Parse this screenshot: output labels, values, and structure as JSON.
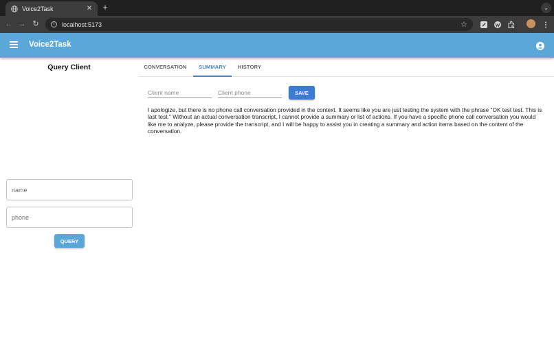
{
  "browser": {
    "tab_title": "Voice2Task",
    "url": "localhost:5173",
    "tab_close_glyph": "✕",
    "new_tab_glyph": "+",
    "tab_list_glyph": "⌄",
    "back_glyph": "←",
    "forward_glyph": "→",
    "reload_glyph": "↻",
    "info_glyph": "i",
    "star_glyph": "☆"
  },
  "appbar": {
    "title": "Voice2Task",
    "menu_icon": "menu-icon",
    "account_icon": "account-circle-icon",
    "color": "#5ba7d8"
  },
  "left_panel": {
    "title": "Query Client",
    "name_placeholder": "name",
    "phone_placeholder": "phone",
    "query_label": "QUERY"
  },
  "tabs": [
    {
      "label": "CONVERSATION",
      "active": false
    },
    {
      "label": "SUMMARY",
      "active": true
    },
    {
      "label": "HISTORY",
      "active": false
    }
  ],
  "summary": {
    "client_name_placeholder": "Client name",
    "client_phone_placeholder": "Client phone",
    "save_label": "SAVE",
    "text": "I apologize, but there is no phone call conversation provided in the context. It seems like you are just testing the system with the phrase \"OK test test. This is last test.\" Without an actual conversation transcript, I cannot provide a summary or list of actions. If you have a specific phone call conversation you would like me to analyze, please provide the transcript, and I will be happy to assist you in creating a summary and action items based on the content of the conversation."
  },
  "colors": {
    "accent": "#4a86c5",
    "save_button": "#3b7bd0"
  }
}
